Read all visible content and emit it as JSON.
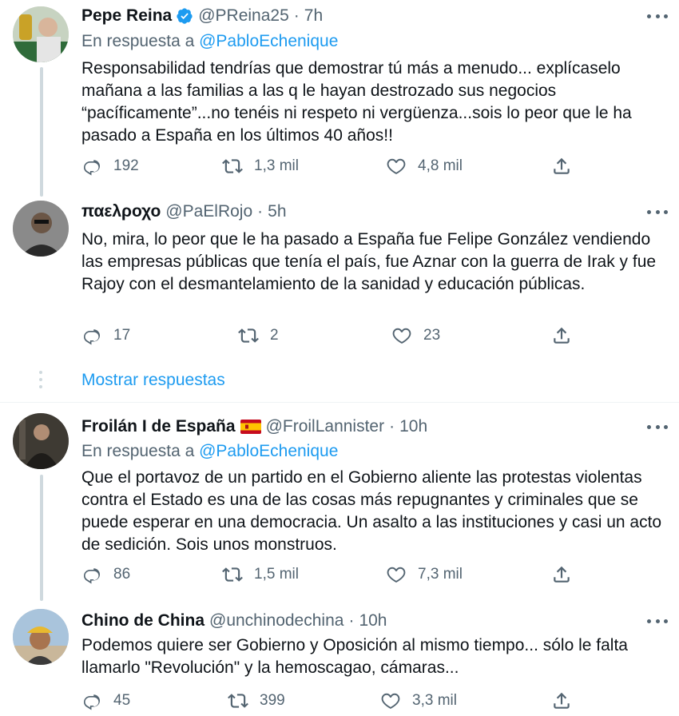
{
  "tweets": [
    {
      "name": "Pepe Reina",
      "handle": "@PReina25",
      "time": "7h",
      "reply_prefix": "En respuesta a",
      "reply_to": "@PabloEchenique",
      "text": "Responsabilidad tendrías que demostrar tú más a menudo... explícaselo mañana a las familias a las q le hayan destrozado sus negocios “pacíficamente”...no tenéis ni respeto ni vergüenza...sois lo peor que le ha pasado a España en los últimos 40 años!!",
      "replies": "192",
      "retweets": "1,3 mil",
      "likes": "4,8 mil"
    },
    {
      "name": "παελροχο",
      "handle": "@PaElRojo",
      "time": "5h",
      "text": "No, mira, lo peor que le ha pasado a España fue Felipe González vendiendo las empresas públicas que tenía el país, fue Aznar con la guerra de Irak y fue Rajoy con el desmantelamiento de la sanidad y educación públicas.",
      "replies": "17",
      "retweets": "2",
      "likes": "23"
    },
    {
      "name": "Froilán I de España",
      "handle": "@FroilLannister",
      "time": "10h",
      "reply_prefix": "En respuesta a",
      "reply_to": "@PabloEchenique",
      "text": "Que el portavoz de un partido en el Gobierno aliente las protestas violentas contra el Estado es una de las cosas más repugnantes y criminales que se puede esperar en una democracia. Un asalto a las instituciones y casi un acto de sedición. Sois unos monstruos.",
      "replies": "86",
      "retweets": "1,5 mil",
      "likes": "7,3 mil"
    },
    {
      "name": "Chino de China",
      "handle": "@unchinodechina",
      "time": "10h",
      "text": "Podemos quiere ser Gobierno y Oposición al mismo tiempo... sólo le falta llamarlo \"Revolución\" y la hemoscagao, cámaras...",
      "replies": "45",
      "retweets": "399",
      "likes": "3,3 mil"
    }
  ],
  "show_more": "Mostrar respuestas",
  "dot": "·",
  "colors": {
    "accent": "#1d9bf0",
    "secondary": "#536471",
    "text": "#0f1419"
  }
}
